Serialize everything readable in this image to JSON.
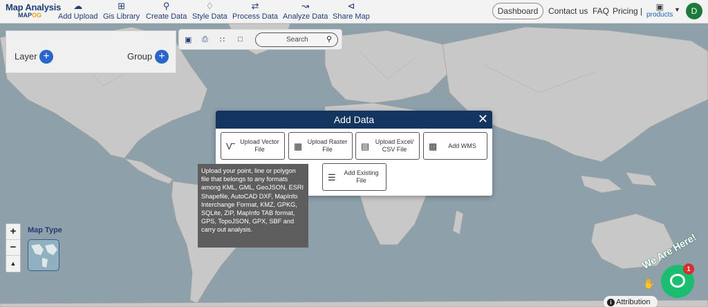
{
  "logo": {
    "title": "Map Analysis",
    "sub_main": "MAP",
    "sub_accent": "OG"
  },
  "nav": [
    {
      "label": "Add Upload",
      "icon": "cloud-upload-icon"
    },
    {
      "label": "Gis Library",
      "icon": "library-plus-icon"
    },
    {
      "label": "Create Data",
      "icon": "map-pin-icon"
    },
    {
      "label": "Style Data",
      "icon": "paint-bucket-icon"
    },
    {
      "label": "Process Data",
      "icon": "process-icon"
    },
    {
      "label": "Analyze Data",
      "icon": "analyze-icon"
    },
    {
      "label": "Share Map",
      "icon": "share-icon"
    }
  ],
  "header_right": {
    "dashboard": "Dashboard",
    "contact": "Contact us",
    "faq": "FAQ",
    "pricing": "Pricing |",
    "products": "products",
    "avatar_initial": "D"
  },
  "layer_panel": {
    "layer_label": "Layer",
    "group_label": "Group"
  },
  "toolbar": {
    "search_label": "Search"
  },
  "map_type": {
    "label": "Map Type"
  },
  "zoom": {
    "in": "+",
    "out": "−"
  },
  "modal": {
    "title": "Add Data",
    "options": [
      {
        "label": "Upload Vector File",
        "icon": "vector-icon"
      },
      {
        "label": "Upload Raster File",
        "icon": "image-icon"
      },
      {
        "label": "Upload Excel/ CSV File",
        "icon": "spreadsheet-icon"
      },
      {
        "label": "Add WMS",
        "icon": "wms-icon"
      },
      {
        "label": "Add Existing File",
        "icon": "database-icon"
      }
    ]
  },
  "tooltip": {
    "text": "Upload your point, line or polygon file that belongs to any formats among KML, GML, GeoJSON, ESRI Shapefile, AutoCAD DXF, MapInfo Interchange Format, KMZ, GPKG, SQLite, ZIP, MapInfo TAB format, GPS, TopoJSON, GPX, SBF and carry out analysis."
  },
  "chat": {
    "tag": "We Are Here!",
    "badge": "1"
  },
  "attribution": "Attribution",
  "colors": {
    "nav_blue": "#1f3c77",
    "modal_header": "#13355f",
    "accent_blue": "#2a66c8",
    "chat_green": "#1dbd71"
  }
}
